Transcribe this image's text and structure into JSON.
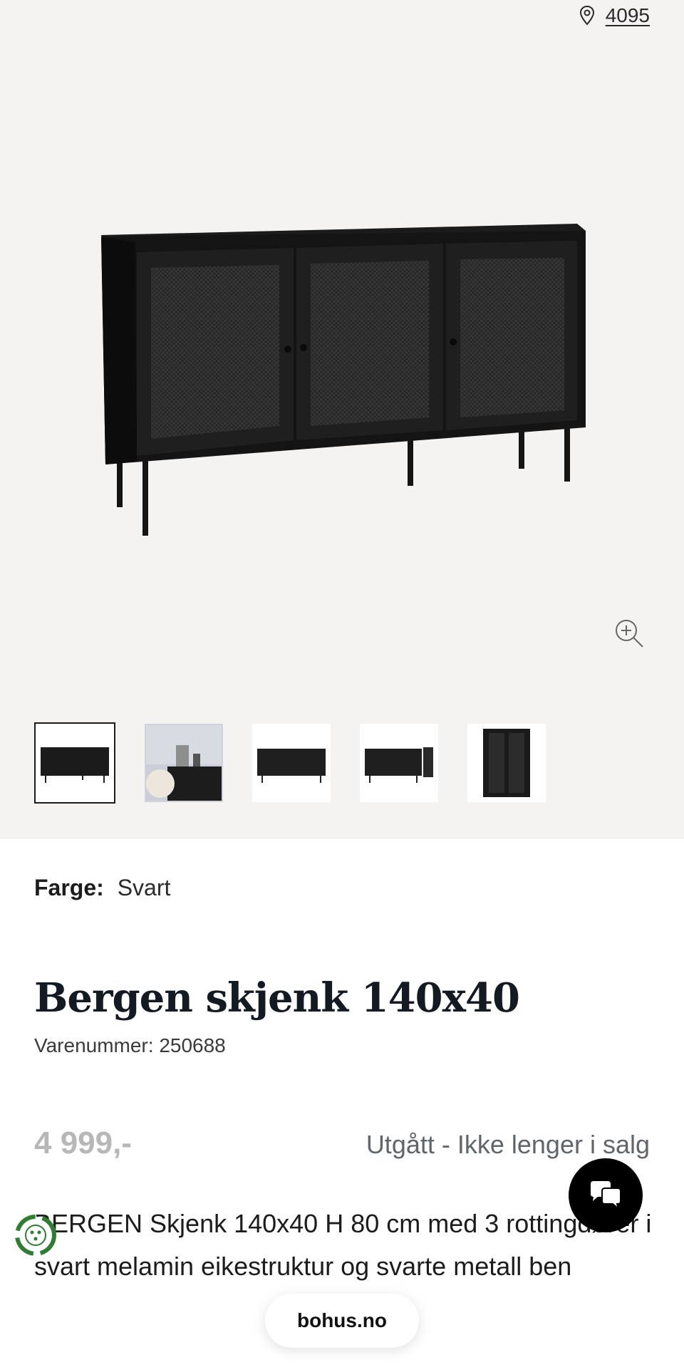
{
  "store": {
    "location_number": "4095",
    "icon": "map-pin-icon"
  },
  "gallery": {
    "zoom_icon": "zoom-in-icon",
    "thumbnails": [
      {
        "name": "thumb-front-view",
        "active": true
      },
      {
        "name": "thumb-room-view",
        "active": false
      },
      {
        "name": "thumb-front-view-2",
        "active": false
      },
      {
        "name": "thumb-open-door-view",
        "active": false
      },
      {
        "name": "thumb-door-closeup",
        "active": false
      }
    ]
  },
  "product": {
    "color_label": "Farge:",
    "color_value": "Svart",
    "title": "Bergen skjenk 140x40",
    "sku_text": "Varenummer: 250688",
    "price": "4 999,-",
    "status": "Utgått - Ikke lenger i salg",
    "description": "BERGEN Skjenk 140x40 H 80 cm med 3 rottingdører i svart melamin eikestruktur og svarte metall ben"
  },
  "chat": {
    "icon": "chat-bubbles-icon"
  },
  "footer": {
    "site_label": "bohus.no"
  },
  "colors": {
    "gallery_bg": "#f5f3f1",
    "price_grey": "#b7b7b7",
    "status_grey": "#5f666b",
    "recycle_green": "#2e7d32"
  }
}
